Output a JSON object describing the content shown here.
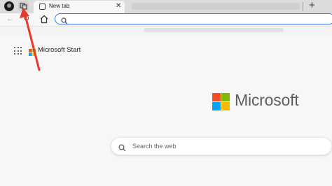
{
  "tabs": [
    {
      "title": "New tab",
      "close_glyph": "✕"
    }
  ],
  "toolbar": {
    "back_glyph": "←",
    "refresh_glyph": "↻",
    "new_tab_glyph": "+",
    "address_value": ""
  },
  "page": {
    "brand_start": "Microsoft Start",
    "brand_logo_text": "Microsoft",
    "search_placeholder": "Search the web"
  },
  "colors": {
    "ms_red": "#f25022",
    "ms_green": "#7fba00",
    "ms_blue": "#00a4ef",
    "ms_yellow": "#ffb900",
    "address_focus": "#3b74e8",
    "annotation_arrow": "#e8392b"
  },
  "icons": [
    "profile-icon",
    "workspaces-icon",
    "tab-page-icon",
    "close-icon",
    "new-tab-icon",
    "back-icon",
    "refresh-icon",
    "home-icon",
    "search-icon",
    "apps-grid-icon",
    "microsoft-logo"
  ]
}
